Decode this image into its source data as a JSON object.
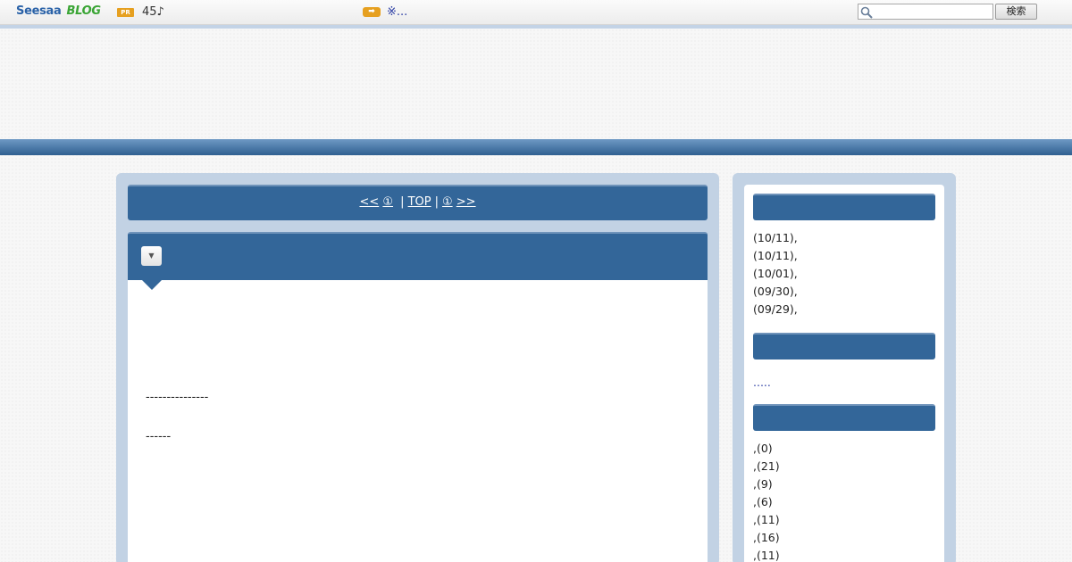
{
  "toolbar": {
    "logo_seesaa": "Seesaa",
    "logo_blog": "BLOG",
    "pr_label": "PR",
    "pr_text": "45♪",
    "arrow_label": "➡",
    "notice_text": "※...",
    "search_placeholder": "",
    "search_button": "検索"
  },
  "pager": {
    "prev": "<<",
    "prev_num": "①",
    "sep1": "|",
    "top": "TOP",
    "sep2": "|",
    "next_num": "①",
    "next": ">>"
  },
  "entry": {
    "toggle": "▼",
    "line1": "---------------",
    "line2": "------"
  },
  "sidebar": {
    "recent_entries": [
      "(10/11),",
      "(10/11),",
      "(10/01),",
      "(09/30),",
      "(09/29),"
    ],
    "more_link": ".....",
    "categories": [
      ",(0)",
      ",(21)",
      ",(9)",
      ",(6)",
      ",(11)",
      ",(16)",
      ",(11)"
    ]
  },
  "colors": {
    "header_blue": "#336699",
    "panel_bg": "#c2d2e4",
    "accent_orange": "#e6a020",
    "link_blue": "#2c3ea4"
  }
}
